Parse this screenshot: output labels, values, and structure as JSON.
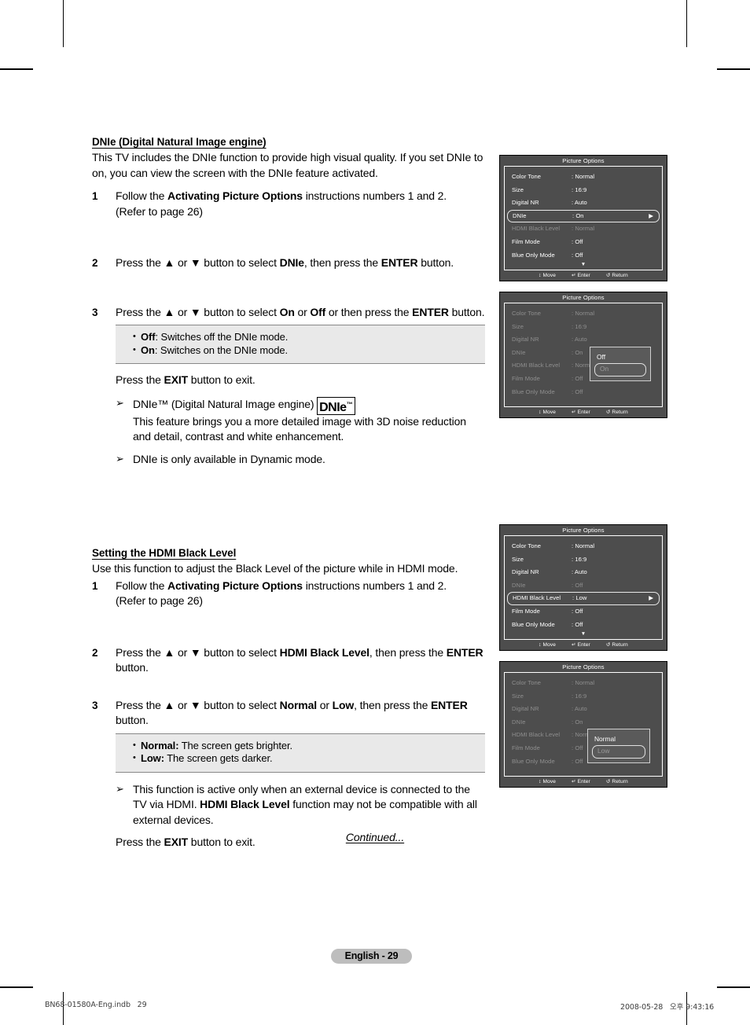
{
  "document": {
    "page_badge": "English - 29",
    "continued": "Continued...",
    "footer_left": "BN68-01580A-Eng.indb   29",
    "footer_right": "2008-05-28   오후 9:43:16"
  },
  "section_dnie": {
    "title": "DNIe (Digital Natural Image engine)",
    "intro": "This TV includes the DNIe function to provide high visual quality. If you set DNIe to on, you can view the screen with the DNIe feature activated.",
    "step1_num": "1",
    "step1_a": "Follow the ",
    "step1_b": "Activating Picture Options",
    "step1_c": " instructions numbers 1 and 2.",
    "step1_d": "(Refer to page 26)",
    "step2_num": "2",
    "step2_a": "Press the ▲ or ▼ button to select ",
    "step2_b": "DNIe",
    "step2_c": ", then press the ",
    "step2_d": "ENTER",
    "step2_e": " button.",
    "step3_num": "3",
    "step3_a": "Press the ▲ or ▼ button to select ",
    "step3_b": "On",
    "step3_c": " or ",
    "step3_d": "Off",
    "step3_e": " or then press the ",
    "step3_f": "ENTER",
    "step3_g": " button.",
    "note_off_b": "Off",
    "note_off_t": ": Switches off the DNIe mode.",
    "note_on_b": "On",
    "note_on_t": ": Switches on the DNIe mode.",
    "exit_a": "Press the ",
    "exit_b": "EXIT",
    "exit_c": " button to exit.",
    "bullet1_a": "DNIe™ (Digital Natural Image engine) ",
    "bullet1_logo": "DNIe",
    "bullet1_logo_tm": "™",
    "bullet1_b": "This feature brings you a more detailed image with 3D noise reduction and detail, contrast and white enhancement.",
    "bullet2": "DNIe is only available in Dynamic mode.",
    "arrow_glyph": "➢"
  },
  "section_hdmi": {
    "title": "Setting the HDMI Black Level",
    "intro": "Use this function to adjust the Black Level of the picture while in HDMI mode.",
    "step1_num": "1",
    "step1_a": "Follow the ",
    "step1_b": "Activating Picture Options",
    "step1_c": " instructions numbers 1 and 2.",
    "step1_d": "(Refer to page 26)",
    "step2_num": "2",
    "step2_a": "Press the ▲ or ▼ button to select ",
    "step2_b": "HDMI Black Level",
    "step2_c": ", then press the ",
    "step2_d": "ENTER",
    "step2_e": " button.",
    "step3_num": "3",
    "step3_a": "Press the ▲ or ▼ button to select ",
    "step3_b": "Normal",
    "step3_c": " or ",
    "step3_d": "Low",
    "step3_e": ", then press the ",
    "step3_f": "ENTER",
    "step3_g": " button.",
    "note_normal_b": "Normal:",
    "note_normal_t": " The screen gets brighter.",
    "note_low_b": "Low:",
    "note_low_t": " The screen gets darker.",
    "bullet1_a": "This function is active only when an external device is connected to the TV via HDMI. ",
    "bullet1_b": "HDMI Black Level",
    "bullet1_c": " function may not be compatible with all external devices.",
    "exit_a": "Press the ",
    "exit_b": "EXIT",
    "exit_c": " button to exit."
  },
  "osd_common": {
    "title": "Picture Options",
    "foot_move": "Move",
    "foot_enter": "Enter",
    "foot_return": "Return",
    "foot_move_icon": "↕",
    "foot_enter_icon": "↵",
    "foot_return_icon": "↺",
    "caret": "▼",
    "right_arrow": "▶",
    "colors": {
      "menu_bg": "#4d4d4d",
      "popup_bg": "#5a5a5a",
      "text": "#ffffff",
      "dim_text": "#8e8e8e",
      "border": "#ffffff"
    }
  },
  "osd1": {
    "rows": [
      {
        "label": "Color Tone",
        "value": ": Normal",
        "state": "normal"
      },
      {
        "label": "Size",
        "value": ": 16:9",
        "state": "normal"
      },
      {
        "label": "Digital NR",
        "value": ": Auto",
        "state": "normal"
      },
      {
        "label": "DNIe",
        "value": ": On",
        "state": "selected"
      },
      {
        "label": "HDMI Black Level",
        "value": ": Normal",
        "state": "dim"
      },
      {
        "label": "Film Mode",
        "value": ": Off",
        "state": "normal"
      },
      {
        "label": "Blue Only Mode",
        "value": ": Off",
        "state": "normal"
      }
    ]
  },
  "osd2": {
    "rows": [
      {
        "label": "Color Tone",
        "value": ": Normal",
        "state": "dim"
      },
      {
        "label": "Size",
        "value": ": 16:9",
        "state": "dim"
      },
      {
        "label": "Digital NR",
        "value": ": Auto",
        "state": "dim"
      },
      {
        "label": "DNIe",
        "value": ": On",
        "state": "dim"
      },
      {
        "label": "HDMI Black Level",
        "value": ": Normal",
        "state": "dim"
      },
      {
        "label": "Film Mode",
        "value": ": Off",
        "state": "dim"
      },
      {
        "label": "Blue Only Mode",
        "value": ": Off",
        "state": "dim"
      }
    ],
    "popup": {
      "options": [
        "Off",
        "On"
      ],
      "current": "On"
    }
  },
  "osd3": {
    "rows": [
      {
        "label": "Color Tone",
        "value": ": Normal",
        "state": "normal"
      },
      {
        "label": "Size",
        "value": ": 16:9",
        "state": "normal"
      },
      {
        "label": "Digital NR",
        "value": ": Auto",
        "state": "normal"
      },
      {
        "label": "DNIe",
        "value": ": Off",
        "state": "dim"
      },
      {
        "label": "HDMI Black Level",
        "value": ": Low",
        "state": "selected"
      },
      {
        "label": "Film Mode",
        "value": ": Off",
        "state": "normal"
      },
      {
        "label": "Blue Only Mode",
        "value": ": Off",
        "state": "normal"
      }
    ]
  },
  "osd4": {
    "rows": [
      {
        "label": "Color Tone",
        "value": ": Normal",
        "state": "dim"
      },
      {
        "label": "Size",
        "value": ": 16:9",
        "state": "dim"
      },
      {
        "label": "Digital NR",
        "value": ": Auto",
        "state": "dim"
      },
      {
        "label": "DNIe",
        "value": ": On",
        "state": "dim"
      },
      {
        "label": "HDMI Black Level",
        "value": ": Normal",
        "state": "dim"
      },
      {
        "label": "Film Mode",
        "value": ": Off",
        "state": "dim"
      },
      {
        "label": "Blue Only Mode",
        "value": ": Off",
        "state": "dim"
      }
    ],
    "popup": {
      "options": [
        "Normal",
        "Low"
      ],
      "current": "Low"
    }
  }
}
